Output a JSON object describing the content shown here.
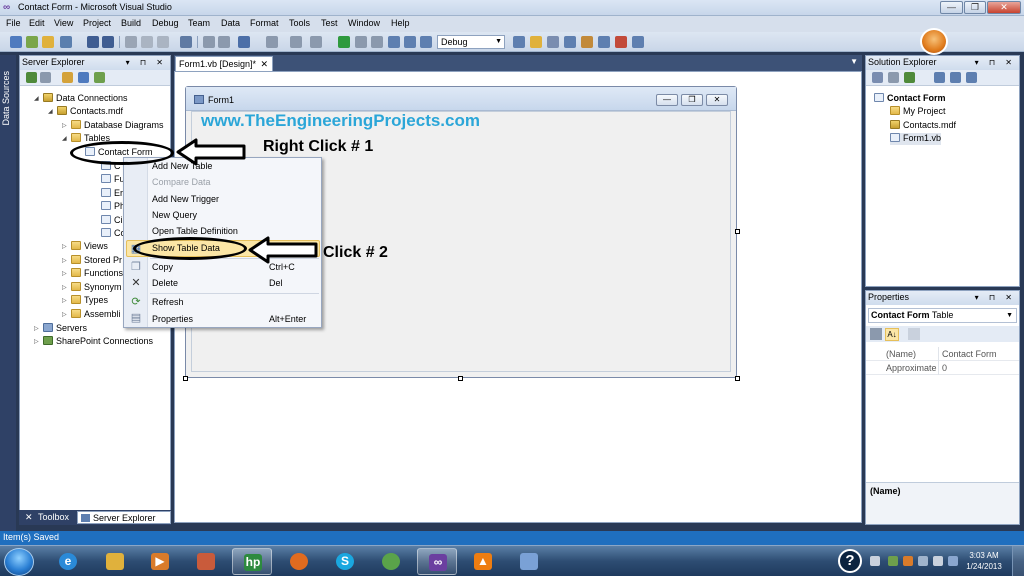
{
  "window": {
    "title": "Contact Form - Microsoft Visual Studio",
    "minimize": "—",
    "maximize": "❐",
    "close": "✕"
  },
  "menubar": [
    "File",
    "Edit",
    "View",
    "Project",
    "Build",
    "Debug",
    "Team",
    "Data",
    "Format",
    "Tools",
    "Test",
    "Window",
    "Help"
  ],
  "toolbar": {
    "configuration": "Debug"
  },
  "left_strip": {
    "label": "Data Sources"
  },
  "server_explorer": {
    "title": "Server Explorer",
    "pin_buttons": "▾ ⊓ ✕",
    "tree": {
      "data_connections": "Data Connections",
      "contacts_mdf": "Contacts.mdf",
      "database_diagrams": "Database Diagrams",
      "tables": "Tables",
      "contact_form": "Contact Form",
      "columns": [
        "C",
        "Fu",
        "Er",
        "Ph",
        "Ci",
        "Co"
      ],
      "views": "Views",
      "stored_procedures": "Stored Pr",
      "functions": "Functions",
      "synonyms": "Synonym",
      "types": "Types",
      "assemblies": "Assembli",
      "servers": "Servers",
      "sharepoint": "SharePoint Connections"
    }
  },
  "bottom_tabs": {
    "toolbox": "Toolbox",
    "server_explorer": "Server Explorer"
  },
  "document": {
    "tab_label": "Form1.vb [Design]*",
    "tab_close": "✕",
    "form_title": "Form1",
    "watermark": "www.TheEngineeringProjects.com"
  },
  "context_menu": {
    "items": [
      {
        "label": "Add New Table",
        "shortcut": ""
      },
      {
        "label": "Compare Data",
        "shortcut": ""
      },
      {
        "label": "Add New Trigger",
        "shortcut": ""
      },
      {
        "label": "New Query",
        "shortcut": ""
      },
      {
        "label": "Open Table Definition",
        "shortcut": ""
      },
      {
        "label": "Show Table Data",
        "shortcut": ""
      },
      {
        "label": "Copy",
        "shortcut": "Ctrl+C"
      },
      {
        "label": "Delete",
        "shortcut": "Del"
      },
      {
        "label": "Refresh",
        "shortcut": ""
      },
      {
        "label": "Properties",
        "shortcut": "Alt+Enter"
      }
    ],
    "delete_icon": "✕"
  },
  "annotations": {
    "click1": "Right Click # 1",
    "click2": "Click # 2"
  },
  "solution_explorer": {
    "title": "Solution Explorer",
    "pin_buttons": "▾ ⊓ ✕",
    "project": "Contact Form",
    "items": [
      "My Project",
      "Contacts.mdf",
      "Form1.vb"
    ]
  },
  "properties": {
    "title": "Properties",
    "pin_buttons": "▾ ⊓ ✕",
    "object_name": "Contact Form",
    "object_type": "Table",
    "rows": [
      {
        "key": "(Name)",
        "value": "Contact Form"
      },
      {
        "key": "Approximate",
        "value": "0"
      }
    ],
    "description_title": "(Name)"
  },
  "status": {
    "text": "Item(s) Saved"
  },
  "taskbar": {
    "help": "?",
    "time": "3:03 AM",
    "date": "1/24/2013"
  }
}
